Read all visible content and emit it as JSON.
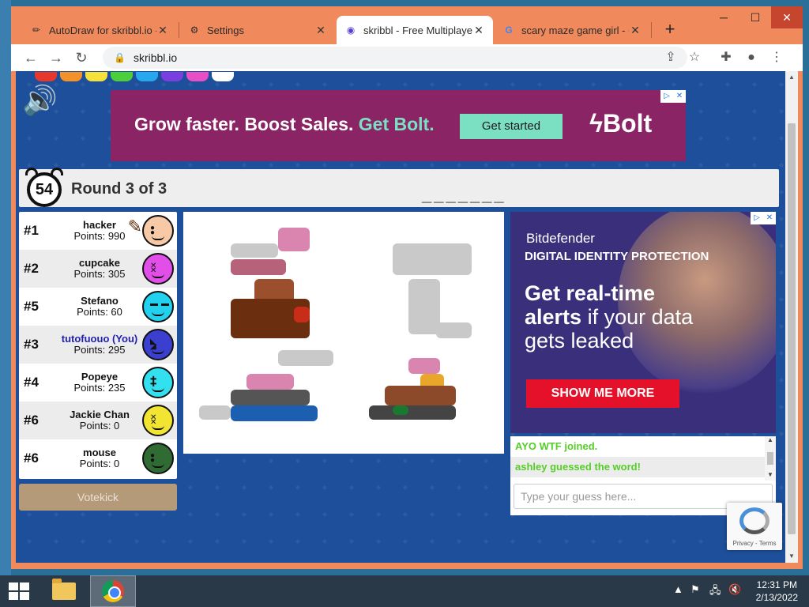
{
  "browser": {
    "tabs": [
      {
        "title": "AutoDraw for skribbl.io -",
        "icon": "autodraw-favicon"
      },
      {
        "title": "Settings",
        "icon": "gear-icon"
      },
      {
        "title": "skribbl - Free Multiplayer",
        "icon": "skribbl-favicon"
      },
      {
        "title": "scary maze game girl - G",
        "icon": "google-icon"
      }
    ],
    "url": "skribbl.io"
  },
  "ad_top": {
    "headline_part1": "Grow faster. Boost Sales. ",
    "headline_part2": "Get Bolt.",
    "cta": "Get started",
    "brand": "Bolt"
  },
  "game": {
    "timer": "54",
    "round": "Round 3 of 3",
    "word_hint": "_______"
  },
  "players": [
    {
      "rank": "#1",
      "name": "hacker",
      "points": "Points: 990",
      "color": "#f7c9a6"
    },
    {
      "rank": "#2",
      "name": "cupcake",
      "points": "Points: 305",
      "color": "#e14fe8"
    },
    {
      "rank": "#5",
      "name": "Stefano",
      "points": "Points: 60",
      "color": "#22d1ee"
    },
    {
      "rank": "#3",
      "name": "tutofuouo (You)",
      "points": "Points: 295",
      "color": "#3a3fcf"
    },
    {
      "rank": "#4",
      "name": "Popeye",
      "points": "Points: 235",
      "color": "#33e0f0"
    },
    {
      "rank": "#6",
      "name": "Jackie Chan",
      "points": "Points: 0",
      "color": "#f2e532"
    },
    {
      "rank": "#6",
      "name": "mouse",
      "points": "Points: 0",
      "color": "#2f6b32"
    }
  ],
  "votekick_label": "Votekick",
  "ad_side": {
    "brand": "Bitdefender",
    "subtitle": "DIGITAL IDENTITY PROTECTION",
    "line1_bold": "Get real-time",
    "line2_bold": "alerts",
    "line2_rest": " if your data",
    "line3": "gets leaked",
    "cta": "SHOW ME MORE"
  },
  "chat": {
    "messages": [
      "AYO WTF joined.",
      "ashley guessed the word!"
    ],
    "placeholder": "Type your guess here..."
  },
  "recaptcha": {
    "links": "Privacy - Terms"
  },
  "taskbar": {
    "time": "12:31 PM",
    "date": "2/13/2022"
  }
}
